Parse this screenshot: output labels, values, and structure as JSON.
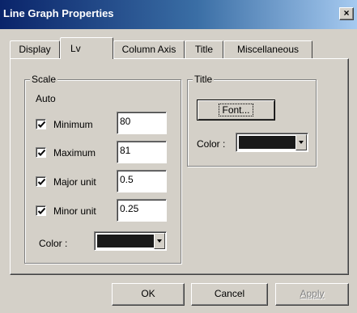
{
  "window": {
    "title": "Line Graph Properties",
    "close_glyph": "×"
  },
  "tabs": [
    {
      "label": "Display",
      "active": false
    },
    {
      "label": "Lv",
      "active": true
    },
    {
      "label": "Column Axis",
      "active": false
    },
    {
      "label": "Title",
      "active": false
    },
    {
      "label": "Miscellaneous",
      "active": false
    }
  ],
  "scale": {
    "legend": "Scale",
    "auto_label": "Auto",
    "rows": [
      {
        "label": "Minimum",
        "checked": true,
        "value": "80"
      },
      {
        "label": "Maximum",
        "checked": true,
        "value": "81"
      },
      {
        "label": "Major unit",
        "checked": true,
        "value": "0.5"
      },
      {
        "label": "Minor unit",
        "checked": true,
        "value": "0.25"
      }
    ],
    "color_label": "Color :",
    "color_value": "#1a1a1a"
  },
  "title_group": {
    "legend": "Title",
    "font_button": "Font...",
    "color_label": "Color :",
    "color_value": "#1a1a1a"
  },
  "buttons": {
    "ok": "OK",
    "cancel": "Cancel",
    "apply": "Apply"
  }
}
